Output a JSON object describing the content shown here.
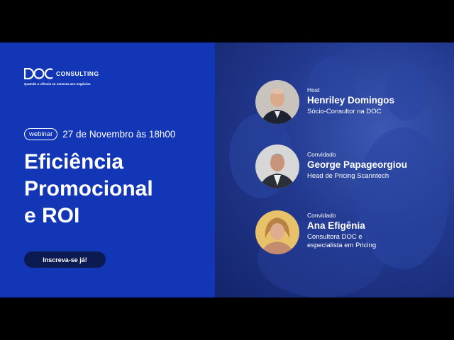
{
  "logo": {
    "mark": "DOC",
    "consulting": "CONSULTING",
    "tagline": "Quando a ciência se conecta aos negócios"
  },
  "webinar": {
    "badge": "webinar",
    "date": "27 de Novembro às 18h00"
  },
  "title": {
    "line1": "Eficiência",
    "line2": "Promocional",
    "line3": "e ROI"
  },
  "cta": {
    "label": "Inscreva-se já!"
  },
  "speakers": [
    {
      "role": "Host",
      "name": "Henriley Domingos",
      "job_line1": "Sócio-Consultor na DOC",
      "job_line2": ""
    },
    {
      "role": "Convidado",
      "name": "George Papageorgiou",
      "job_line1": "Head de Pricing Scanntech",
      "job_line2": ""
    },
    {
      "role": "Convidado",
      "name": "Ana Efigênia",
      "job_line1": "Consultora DOC e",
      "job_line2": "especialista em Pricing"
    }
  ],
  "colors": {
    "panel_blue": "#1236b5",
    "cta_navy": "#0c1a52",
    "text": "#ffffff"
  },
  "icons": {
    "logo": "doc-logo-icon",
    "avatars": [
      "speaker-photo-henriley",
      "speaker-photo-george",
      "speaker-photo-ana"
    ]
  }
}
